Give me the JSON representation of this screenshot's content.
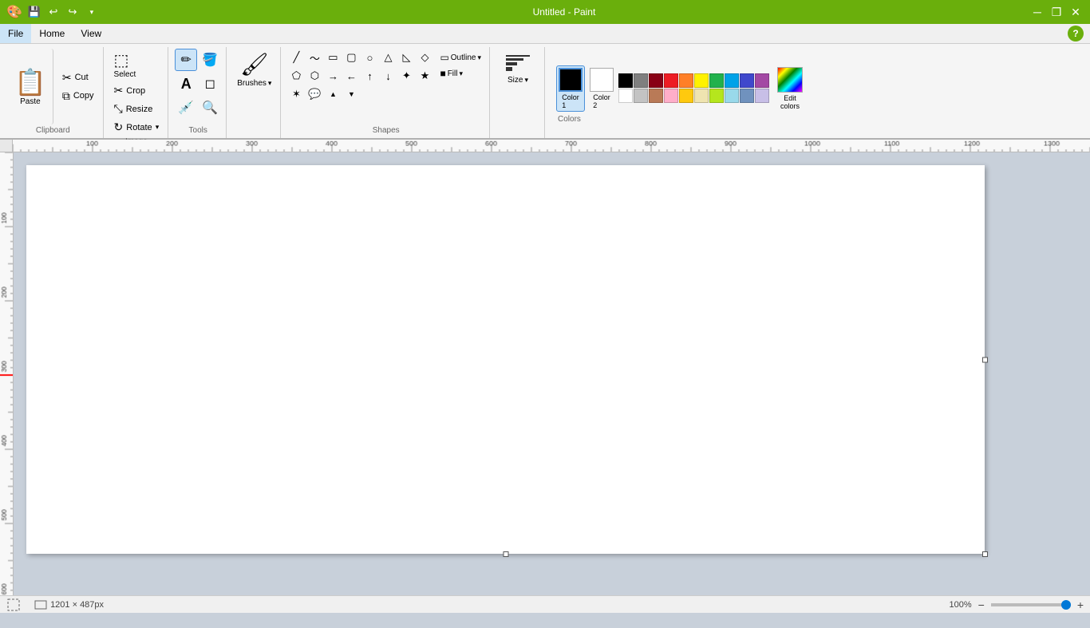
{
  "titlebar": {
    "title": "Untitled - Paint",
    "minimize": "─",
    "maximize": "❐",
    "close": "✕"
  },
  "quickaccess": {
    "save": "💾",
    "undo": "↩",
    "redo": "↪",
    "dropdown": "▾"
  },
  "menu": {
    "file": "File",
    "home": "Home",
    "view": "View"
  },
  "clipboard": {
    "group_label": "Clipboard",
    "paste_label": "Paste",
    "cut_label": "Cut",
    "copy_label": "Copy"
  },
  "image": {
    "group_label": "Image",
    "crop_label": "Crop",
    "resize_label": "Resize",
    "rotate_label": "Rotate"
  },
  "tools": {
    "group_label": "Tools"
  },
  "brushes": {
    "group_label": "Brushes",
    "label": "Brushes"
  },
  "shapes": {
    "group_label": "Shapes",
    "outline_label": "Outline",
    "fill_label": "Fill"
  },
  "size": {
    "group_label": "Size",
    "label": "Size"
  },
  "colors": {
    "group_label": "Colors",
    "color1_label": "Color\n1",
    "color2_label": "Color\n2",
    "edit_label": "Edit\ncolors"
  },
  "select": {
    "label": "Select"
  },
  "statusbar": {
    "dimensions": "1201 × 487px",
    "zoom": "100%",
    "zoom_minus": "−",
    "zoom_plus": "+"
  },
  "palette": {
    "row1": [
      "#000000",
      "#7f7f7f",
      "#880015",
      "#ed1c24",
      "#ff7f27",
      "#fff200",
      "#22b14c",
      "#00a2e8",
      "#3f48cc",
      "#a349a4"
    ],
    "row2": [
      "#ffffff",
      "#c3c3c3",
      "#b97a57",
      "#ffaec9",
      "#ffc90e",
      "#efe4b0",
      "#b5e61d",
      "#99d9ea",
      "#7092be",
      "#c8bfe7"
    ]
  }
}
